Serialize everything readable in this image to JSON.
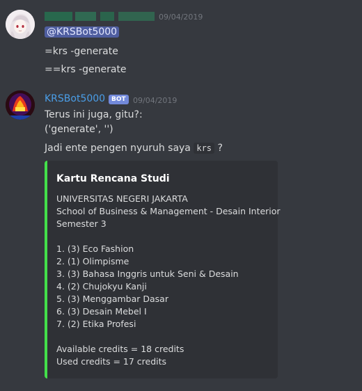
{
  "messages": [
    {
      "timestamp": "09/04/2019",
      "lines": {
        "mention": "@KRSBot5000",
        "cmd1": "=krs -generate",
        "cmd2": "==krs -generate"
      }
    },
    {
      "author": "KRSBot5000",
      "badge": "BOT",
      "timestamp": "09/04/2019",
      "line1": "Terus ini juga, gitu?:",
      "line2": "('generate', '')",
      "line3_prefix": "Jadi ente pengen nyuruh saya ",
      "line3_code": "krs",
      "line3_suffix": " ?",
      "embed": {
        "title": "Kartu Rencana Studi",
        "university": "UNIVERSITAS NEGERI JAKARTA",
        "program": "School of Business & Management - Desain Interior",
        "semester": "Semester 3",
        "courses": [
          "1. (3) Eco Fashion",
          "2. (1) Olimpisme",
          "3. (3) Bahasa Inggris untuk Seni & Desain",
          "4. (2) Chujokyu Kanji",
          "5. (3) Menggambar Dasar",
          "6. (3) Desain Mebel I",
          "7. (2) Etika Profesi"
        ],
        "available": "Available credits = 18 credits",
        "used": "Used credits = 17 credits",
        "accent_color": "#43e04a"
      }
    }
  ],
  "colors": {
    "background": "#36393f",
    "bot_name": "#4a9ee8",
    "mention_bg": "#4f5ea0"
  }
}
